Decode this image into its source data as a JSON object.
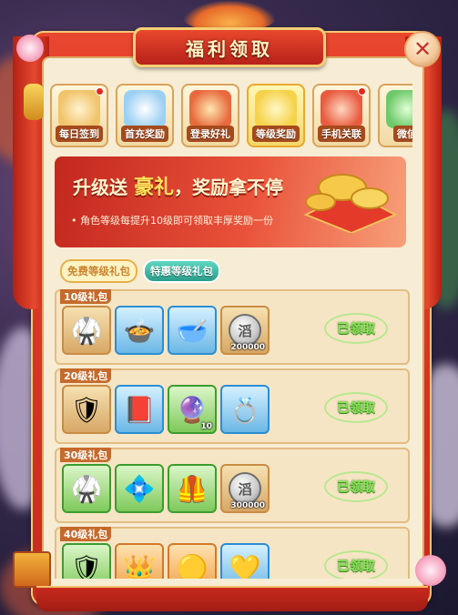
{
  "title": "福利领取",
  "tabs": [
    {
      "label": "每日签到",
      "art_color": "#f1c36a",
      "red_dot": true,
      "active": false
    },
    {
      "label": "首充奖励",
      "art_color": "#9bd0f3",
      "red_dot": false,
      "active": false
    },
    {
      "label": "登录好礼",
      "art_color": "#e76a3d",
      "red_dot": false,
      "active": false
    },
    {
      "label": "等级奖励",
      "art_color": "#f6d24a",
      "red_dot": false,
      "active": true
    },
    {
      "label": "手机关联",
      "art_color": "#e85b3f",
      "red_dot": true,
      "active": false
    },
    {
      "label": "微信",
      "art_color": "#6dc96a",
      "red_dot": false,
      "active": false
    }
  ],
  "promo": {
    "headline_pre": "升级送",
    "headline_hl": "豪礼",
    "headline_post": "，奖励拿不停",
    "desc": "• 角色等级每提升10级即可领取丰厚奖励一份"
  },
  "subtabs": {
    "free": "免费等级礼包",
    "special": "特惠等级礼包"
  },
  "rows": [
    {
      "label": "10级礼包",
      "claimed": "已领取",
      "items": [
        {
          "icon": "armor-icon",
          "frame": "normal",
          "glyph": "🥋",
          "count": ""
        },
        {
          "icon": "soup-bowl-icon",
          "frame": "blue",
          "glyph": "🍲",
          "count": ""
        },
        {
          "icon": "green-soup-icon",
          "frame": "blue",
          "glyph": "🥣",
          "count": ""
        },
        {
          "icon": "silver-coin-icon",
          "frame": "normal",
          "glyph": "",
          "coin": "滔",
          "count": "200000"
        }
      ]
    },
    {
      "label": "20级礼包",
      "claimed": "已领取",
      "items": [
        {
          "icon": "armor-icon",
          "frame": "normal",
          "glyph": "🛡",
          "count": ""
        },
        {
          "icon": "book-icon",
          "frame": "blue",
          "glyph": "📕",
          "count": ""
        },
        {
          "icon": "pink-gem-icon",
          "frame": "green",
          "glyph": "🔮",
          "count": "10"
        },
        {
          "icon": "spiked-ring-icon",
          "frame": "blue",
          "glyph": "💍",
          "count": ""
        }
      ]
    },
    {
      "label": "30级礼包",
      "claimed": "已领取",
      "items": [
        {
          "icon": "armor-icon",
          "frame": "green",
          "glyph": "🥋",
          "count": ""
        },
        {
          "icon": "jade-emblem-icon",
          "frame": "green",
          "glyph": "💠",
          "count": ""
        },
        {
          "icon": "gold-armor-icon",
          "frame": "green",
          "glyph": "🦺",
          "count": ""
        },
        {
          "icon": "silver-coin-icon",
          "frame": "normal",
          "glyph": "",
          "coin": "滔",
          "count": "300000"
        }
      ]
    },
    {
      "label": "40级礼包",
      "claimed": "已领取",
      "items": [
        {
          "icon": "purple-armor-icon",
          "frame": "green",
          "glyph": "🛡",
          "count": ""
        },
        {
          "icon": "red-gem-crown-icon",
          "frame": "orange",
          "glyph": "👑",
          "count": ""
        },
        {
          "icon": "gold-orb-icon",
          "frame": "orange",
          "glyph": "🟡",
          "count": ""
        },
        {
          "icon": "golden-ring-icon",
          "frame": "blue",
          "glyph": "💛",
          "count": ""
        }
      ]
    }
  ]
}
